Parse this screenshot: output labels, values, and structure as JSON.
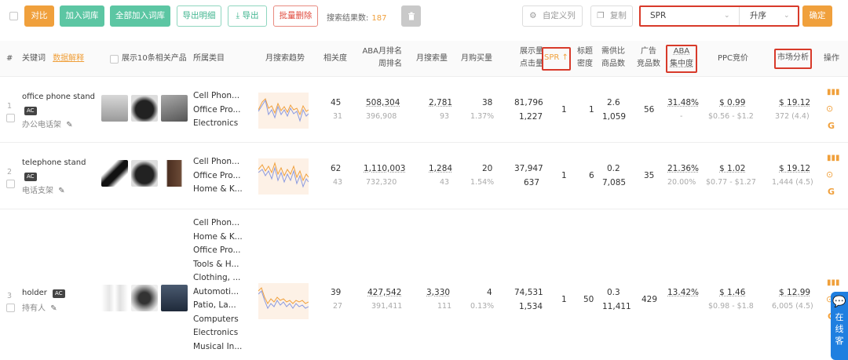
{
  "toolbar": {
    "compare": "对比",
    "add_lexicon": "加入词库",
    "add_all_lexicon": "全部加入词库",
    "export_detail": "导出明细",
    "export": "导出",
    "batch_delete": "批量删除",
    "result_label": "搜索结果数:",
    "result_count": "187",
    "custom_columns": "自定义列",
    "copy": "复制",
    "sort_field": "SPR",
    "sort_order": "升序",
    "confirm": "确定"
  },
  "headers": {
    "index": "#",
    "keyword": "关键词",
    "data_explain": "数据解释",
    "show_products": "展示10条相关产品",
    "category": "所属类目",
    "trend": "月搜索趋势",
    "relevance": "相关度",
    "aba_rank_1": "ABA月排名",
    "aba_rank_2": "周排名",
    "monthly_search": "月搜索量",
    "monthly_purchase": "月购买量",
    "impressions_1": "展示量",
    "impressions_2": "点击量",
    "spr": "SPR",
    "title_1": "标题",
    "title_2": "密度",
    "supply_1": "需供比",
    "supply_2": "商品数",
    "ads_1": "广告",
    "ads_2": "竞品数",
    "aba_conc_1": "ABA",
    "aba_conc_2": "集中度",
    "ppc": "PPC竞价",
    "market": "市场分析",
    "ops": "操作"
  },
  "rows": [
    {
      "index": "1",
      "keyword": "office phone stand",
      "badge": "AC",
      "cn": "办公电话架",
      "categories": [
        "Cell Phon...",
        "Office Pro...",
        "Electronics"
      ],
      "relevance": "45",
      "relevance_sub": "31",
      "aba_month": "508,304",
      "aba_week": "396,908",
      "search": "2,781",
      "search_sub": "93",
      "purchase": "38",
      "purchase_rate": "1.37%",
      "impressions": "81,796",
      "clicks": "1,227",
      "spr": "1",
      "title_density": "1",
      "supply_ratio": "2.6",
      "products": "1,059",
      "ads": "56",
      "aba_conc": "31.48%",
      "aba_conc_sub": "-",
      "ppc": "$ 0.99",
      "ppc_range": "$0.56 - $1.2",
      "market": "$ 19.12",
      "market_sub": "372 (4.4)"
    },
    {
      "index": "2",
      "keyword": "telephone stand",
      "badge": "AC",
      "cn": "电话支架",
      "categories": [
        "Cell Phon...",
        "Office Pro...",
        "Home & K..."
      ],
      "relevance": "62",
      "relevance_sub": "43",
      "aba_month": "1,110,003",
      "aba_week": "732,320",
      "search": "1,284",
      "search_sub": "43",
      "purchase": "20",
      "purchase_rate": "1.54%",
      "impressions": "37,947",
      "clicks": "637",
      "spr": "1",
      "title_density": "6",
      "supply_ratio": "0.2",
      "products": "7,085",
      "ads": "35",
      "aba_conc": "21.36%",
      "aba_conc_sub": "20.00%",
      "ppc": "$ 1.02",
      "ppc_range": "$0.77 - $1.27",
      "market": "$ 19.12",
      "market_sub": "1,444 (4.5)"
    },
    {
      "index": "3",
      "keyword": "holder",
      "badge": "AC",
      "cn": "持有人",
      "categories": [
        "Cell Phon...",
        "Home & K...",
        "Office Pro...",
        "Tools & H...",
        "Clothing, ...",
        "Automoti...",
        "Patio, La...",
        "Computers",
        "Electronics",
        "Musical In..."
      ],
      "relevance": "39",
      "relevance_sub": "27",
      "aba_month": "427,542",
      "aba_week": "391,411",
      "search": "3,330",
      "search_sub": "111",
      "purchase": "4",
      "purchase_rate": "0.13%",
      "impressions": "74,531",
      "clicks": "1,534",
      "spr": "1",
      "title_density": "50",
      "supply_ratio": "0.3",
      "products": "11,411",
      "ads": "429",
      "aba_conc": "13.42%",
      "aba_conc_sub": "",
      "ppc": "$ 1.46",
      "ppc_range": "$0.98 - $1.8",
      "market": "$ 12.99",
      "market_sub": "6,005 (4.5)"
    }
  ],
  "chat": "在线客",
  "icons": {
    "trash": "trash-icon",
    "gear": "gear-icon",
    "copy": "copy-icon",
    "edit": "edit-icon",
    "chart": "bar-chart-icon",
    "more": "more-icon",
    "google": "google-icon",
    "sort_up": "arrow-up-icon"
  },
  "colors": {
    "orange": "#f0a03c",
    "green": "#5cc6a3",
    "red_outline": "#d83a2a"
  }
}
